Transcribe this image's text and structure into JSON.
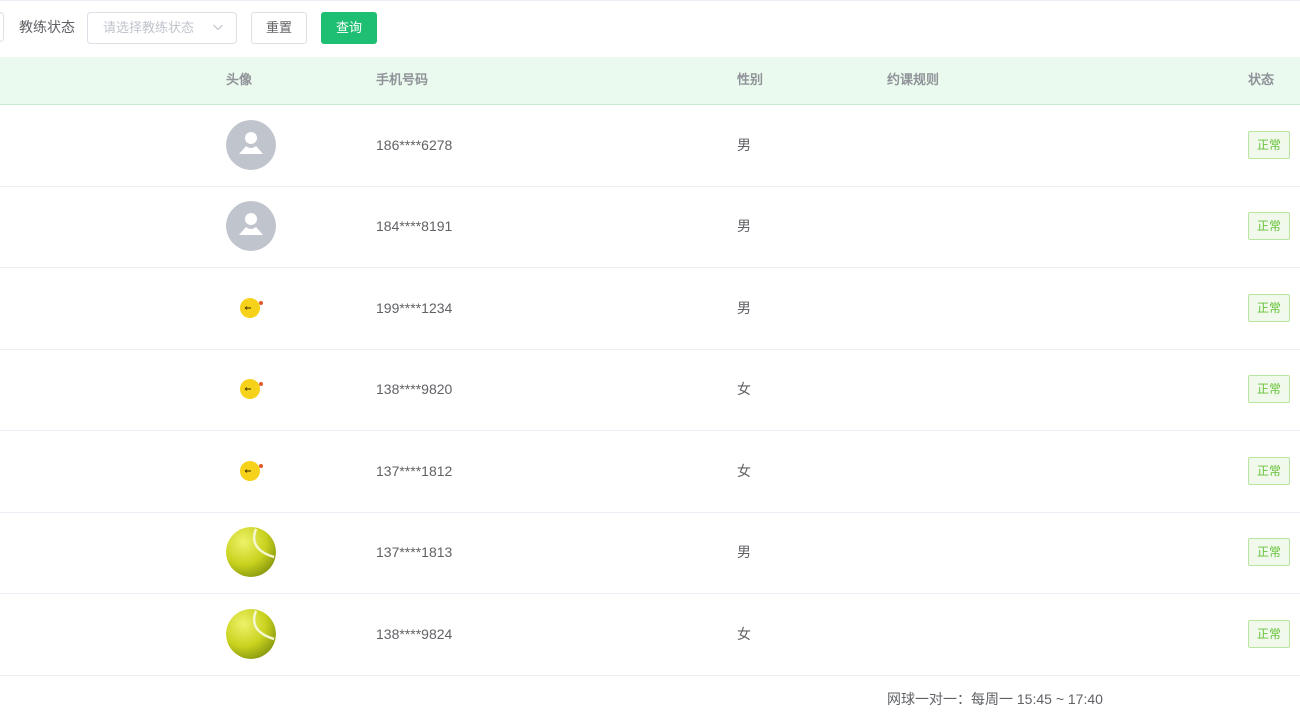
{
  "filter": {
    "label": "教练状态",
    "select_placeholder": "请选择教练状态",
    "reset_label": "重置",
    "query_label": "查询"
  },
  "table": {
    "columns": {
      "avatar": "头像",
      "phone": "手机号码",
      "gender": "性别",
      "rules": "约课规则",
      "status": "状态"
    },
    "rows": [
      {
        "avatar": "default-user-avatar",
        "phone": "186****6278",
        "gender": "男",
        "status": "正常"
      },
      {
        "avatar": "default-user-avatar",
        "phone": "184****8191",
        "gender": "男",
        "status": "正常"
      },
      {
        "avatar": "yellow-chick-avatar",
        "phone": "199****1234",
        "gender": "男",
        "status": "正常"
      },
      {
        "avatar": "yellow-chick-avatar",
        "phone": "138****9820",
        "gender": "女",
        "status": "正常"
      },
      {
        "avatar": "yellow-chick-avatar",
        "phone": "137****1812",
        "gender": "女",
        "status": "正常"
      },
      {
        "avatar": "tennis-ball-avatar",
        "phone": "137****1813",
        "gender": "男",
        "status": "正常"
      },
      {
        "avatar": "tennis-ball-avatar",
        "phone": "138****9824",
        "gender": "女",
        "status": "正常"
      }
    ],
    "next_row_rules": [
      "网球一对一：每周一 15:45 ~ 17:40"
    ]
  },
  "colors": {
    "accent": "#1fbf73",
    "header_bg": "#ebfaef",
    "status_text": "#67c23a",
    "status_border": "#b8e6a0",
    "status_bg": "#f0f9eb"
  }
}
